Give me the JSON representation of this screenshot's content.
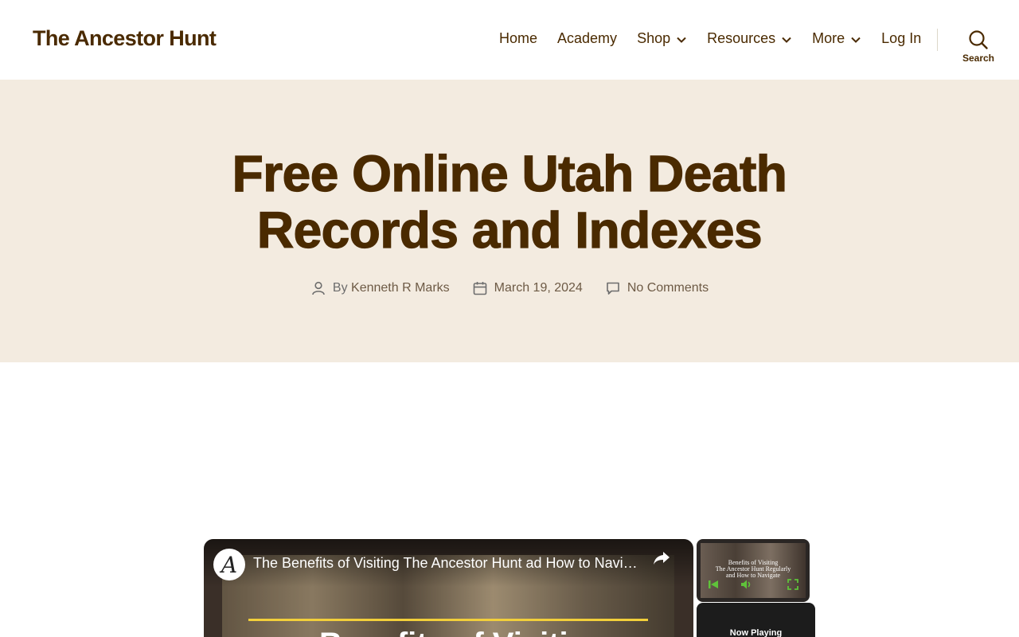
{
  "site": {
    "title": "The Ancestor Hunt"
  },
  "nav": {
    "items": [
      {
        "label": "Home",
        "has_dropdown": false
      },
      {
        "label": "Academy",
        "has_dropdown": false
      },
      {
        "label": "Shop",
        "has_dropdown": true
      },
      {
        "label": "Resources",
        "has_dropdown": true
      },
      {
        "label": "More",
        "has_dropdown": true
      },
      {
        "label": "Log In",
        "has_dropdown": false
      }
    ],
    "search_label": "Search"
  },
  "post": {
    "title_line1": "Free Online Utah Death",
    "title_line2": "Records and Indexes",
    "author_prefix": "By",
    "author": "Kenneth R Marks",
    "date": "March 19, 2024",
    "comments": "No Comments"
  },
  "video": {
    "logo_letter": "A",
    "title": "The Benefits of Visiting The Ancestor Hunt ad How to Navi…",
    "overlay_text": "Benefits of Visiting",
    "thumb_text_line1": "Benefits of Visiting",
    "thumb_text_line2": "The Ancestor Hunt Regularly",
    "thumb_text_line3": "and How to Navigate",
    "now_playing": "Now Playing"
  },
  "colors": {
    "brand": "#4a2a00",
    "hero_bg": "#f3ebe0",
    "accent_line": "#f2cf3a"
  }
}
